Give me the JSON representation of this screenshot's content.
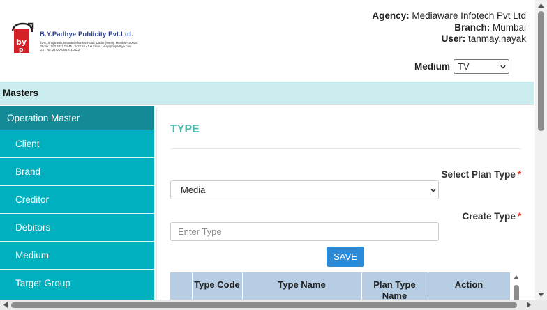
{
  "header": {
    "logo": {
      "company": "B.Y.Padhye Publicity Pvt.Ltd.",
      "address": "22-E, Shujanesh, Bhavani Shankar Road, Dadar (West), Mumbai-400028.",
      "contact": "Phone : 022 2422 04 45 / 2422 52 41  ■  Email : vijay@bypadhye.com",
      "gst": "GST No. 27AAACB1971D1Z2"
    },
    "agency_label": "Agency:",
    "agency_value": "Mediaware Infotech Pvt Ltd",
    "branch_label": "Branch:",
    "branch_value": "Mumbai",
    "user_label": "User:",
    "user_value": "tanmay.nayak",
    "medium_label": "Medium",
    "medium_value": "TV"
  },
  "masters": {
    "label": "Masters"
  },
  "sidebar": {
    "heading": "Operation Master",
    "items": [
      {
        "label": "Client"
      },
      {
        "label": "Brand"
      },
      {
        "label": "Creditor"
      },
      {
        "label": "Debitors"
      },
      {
        "label": "Medium"
      },
      {
        "label": "Target Group"
      }
    ]
  },
  "main": {
    "title": "TYPE",
    "plan_type_label": "Select Plan Type",
    "plan_type_value": "Media",
    "create_type_label": "Create Type",
    "create_type_placeholder": "Enter Type",
    "required_mark": "*",
    "save_label": "SAVE",
    "table_headers": [
      "",
      "Type Code",
      "Type Name",
      "Plan Type Name",
      "Action"
    ]
  },
  "colors": {
    "sidebar_bg": "#00b0be",
    "sidebar_heading_bg": "#138a95",
    "masters_bar_bg": "#ccedef",
    "title_color": "#4db6a9",
    "save_button": "#2d8ad6",
    "table_header_bg": "#b7cde4",
    "required_color": "#e0352b"
  },
  "icons": {
    "medium_dropdown": "chevron-down-icon",
    "plan_type_dropdown": "chevron-down-icon",
    "logo": "bp-logo-icon"
  }
}
